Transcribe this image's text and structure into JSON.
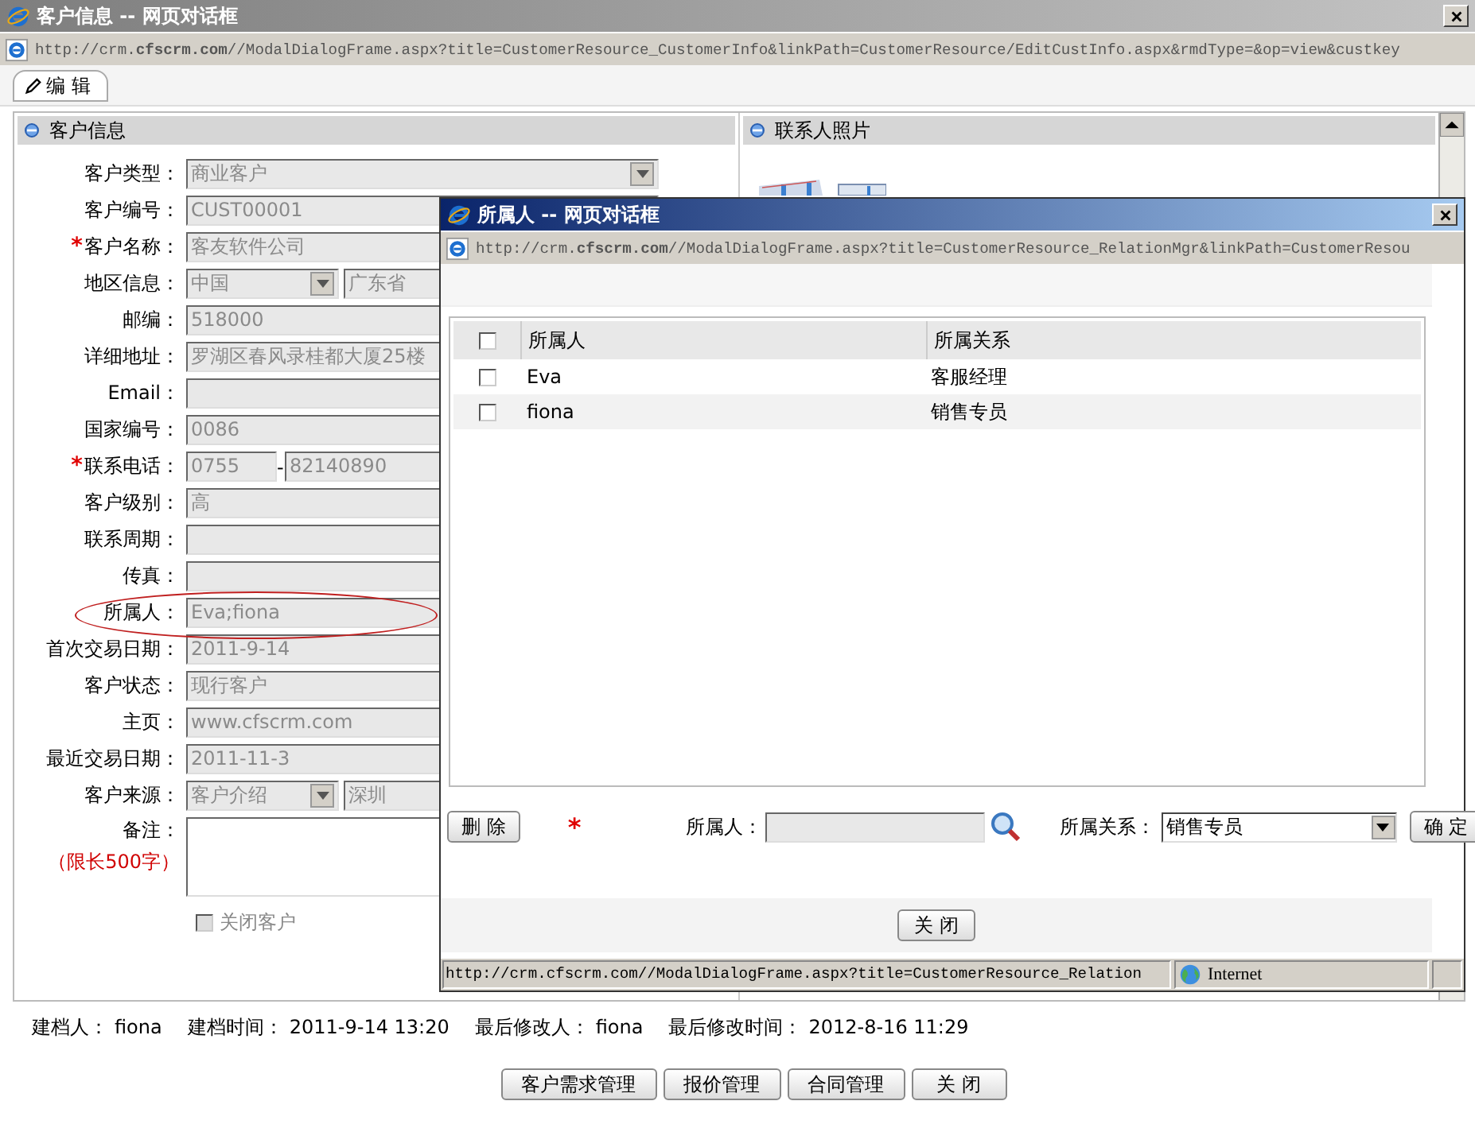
{
  "window": {
    "title": "客户信息 -- 网页对话框",
    "url": "http://crm.**cfscrm.com**//ModalDialogFrame.aspx?title=CustomerResource_CustomerInfo&linkPath=CustomerResource/EditCustInfo.aspx&rmdType=&op=view&custkey"
  },
  "toolbar": {
    "edit_button": "编 辑"
  },
  "customer_panel": {
    "title": "客户信息",
    "fields": [
      {
        "kind": "select",
        "label": "客户类型：",
        "highlighted": false,
        "disabled": true,
        "value": "商业客户"
      },
      {
        "kind": "text",
        "label": "客户编号：",
        "highlighted": false,
        "disabled": true,
        "value": "CUST00001"
      },
      {
        "kind": "text",
        "required_mark": "*",
        "label": "客户名称：",
        "highlighted": false,
        "disabled": true,
        "value": "客友软件公司"
      },
      {
        "kind": "select_text",
        "label": "地区信息：",
        "highlighted": false,
        "disabled": true,
        "value": "中国",
        "value_2": "广东省"
      },
      {
        "kind": "text",
        "label": "邮编：",
        "highlighted": false,
        "disabled": true,
        "value": "518000"
      },
      {
        "kind": "text",
        "label": "详细地址：",
        "highlighted": false,
        "disabled": true,
        "value": "罗湖区春风录桂都大厦25楼"
      },
      {
        "kind": "text",
        "label": "Email：",
        "highlighted": false,
        "disabled": true
      },
      {
        "kind": "text",
        "label": "国家编号：",
        "highlighted": false,
        "disabled": true,
        "value": "0086"
      },
      {
        "kind": "phone",
        "required_mark": "*",
        "label": "联系电话：",
        "highlighted": false,
        "disabled": true,
        "value": "0755",
        "separator": "-",
        "value_2": "82140890"
      },
      {
        "kind": "text",
        "label": "客户级别：",
        "highlighted": false,
        "disabled": true,
        "value": "高"
      },
      {
        "kind": "text",
        "label": "联系周期：",
        "highlighted": false,
        "disabled": true
      },
      {
        "kind": "text",
        "label": "传真：",
        "highlighted": false,
        "disabled": true
      },
      {
        "kind": "text",
        "label": "所属人：",
        "highlighted": true,
        "disabled": true,
        "value": "Eva;fiona"
      },
      {
        "kind": "text",
        "label": "首次交易日期：",
        "highlighted": false,
        "disabled": true,
        "value": "2011-9-14"
      },
      {
        "kind": "text",
        "label": "客户状态：",
        "highlighted": false,
        "disabled": true,
        "value": "现行客户"
      },
      {
        "kind": "text",
        "label": "主页：",
        "highlighted": false,
        "disabled": true,
        "value": "www.cfscrm.com"
      },
      {
        "kind": "text",
        "label": "最近交易日期：",
        "highlighted": false,
        "disabled": true,
        "value": "2011-11-3"
      },
      {
        "kind": "select_text",
        "label": "客户来源：",
        "highlighted": false,
        "disabled": true,
        "value": "客户介绍",
        "value_2": "深圳"
      }
    ],
    "remark": {
      "label": "备注：",
      "note": "（限长500字）"
    },
    "close_customer": {
      "label": "关闭客户",
      "checked": false
    }
  },
  "photo_panel": {
    "title": "联系人照片"
  },
  "record_info": [
    {
      "label": "建档人：",
      "value": "fiona"
    },
    {
      "label": "建档时间：",
      "value": "2011-9-14 13:20"
    },
    {
      "label": "最后修改人：",
      "value": "fiona"
    },
    {
      "label": "最后修改时间：",
      "value": "2012-8-16 11:29"
    }
  ],
  "bottom_buttons": [
    "客户需求管理",
    "报价管理",
    "合同管理",
    "关 闭"
  ],
  "dialog": {
    "title": "所属人 -- 网页对话框",
    "url": "http://crm.**cfscrm.com**//ModalDialogFrame.aspx?title=CustomerResource_RelationMgr&linkPath=CustomerResou",
    "table": {
      "columns": [
        "所属人",
        "所属关系"
      ],
      "all_checked": false,
      "rows": [
        {
          "owner": "Eva",
          "relation": "客服经理",
          "checked": false
        },
        {
          "owner": "fiona",
          "relation": "销售专员",
          "checked": false
        }
      ]
    },
    "delete_button": "删 除",
    "owner_field": {
      "required_mark": "*",
      "label": "所属人："
    },
    "relation_field": {
      "label": "所属关系：",
      "value": "销售专员"
    },
    "confirm_button": "确 定",
    "close_button": "关 闭",
    "status_bar": {
      "url": "http://crm.cfscrm.com//ModalDialogFrame.aspx?title=CustomerResource_Relation",
      "zone": "Internet"
    }
  }
}
